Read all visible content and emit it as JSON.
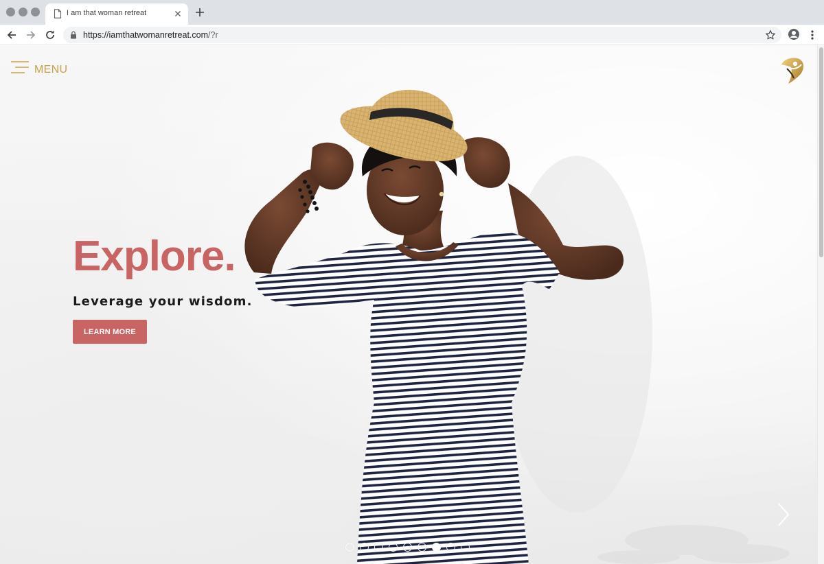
{
  "browser": {
    "tab_title": "I am that woman retreat",
    "url_host": "https://iamthatwomanretreat.com",
    "url_path": "/?r",
    "accent": "#dee1e6"
  },
  "page": {
    "menu_label": "MENU",
    "headline": "Explore.",
    "subheadline": "Leverage your wisdom.",
    "cta_label": "LEARN MORE",
    "carousel": {
      "slide_count": 9,
      "active_slide": 7
    },
    "colors": {
      "brand_gold": "#c9a04a",
      "brand_rose": "#c96464",
      "text_dark": "#1b1b1b"
    },
    "icons": {
      "menu": "hamburger-icon",
      "logo": "woman-figure-logo-icon",
      "next": "chevron-right-icon"
    }
  }
}
